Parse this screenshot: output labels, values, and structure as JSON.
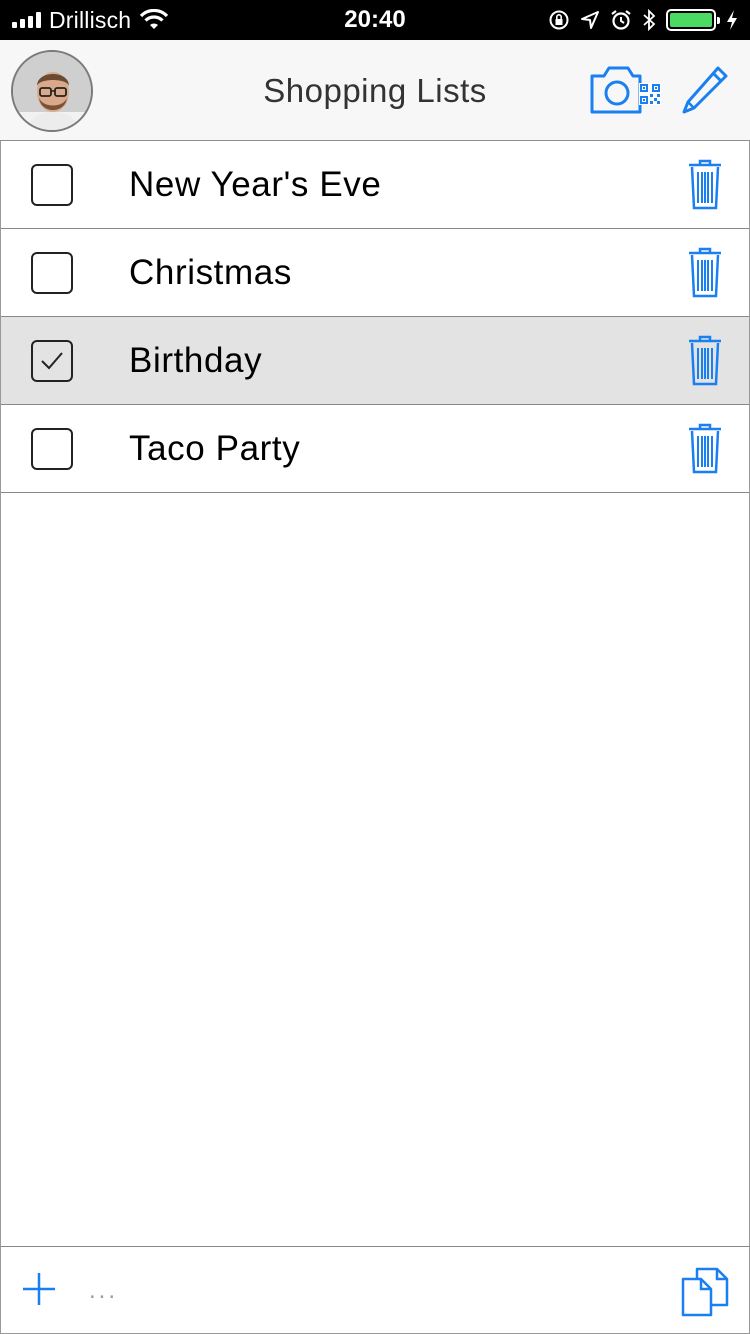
{
  "status_bar": {
    "carrier": "Drillisch",
    "time": "20:40",
    "battery_color": "#4cd964"
  },
  "nav": {
    "title": "Shopping Lists",
    "avatar_icon": "user-avatar",
    "scan_icon": "camera-qr-icon",
    "edit_icon": "pencil-icon",
    "accent_color": "#1a7ff0"
  },
  "lists": [
    {
      "label": "New Year's Eve",
      "checked": false
    },
    {
      "label": "Christmas",
      "checked": false
    },
    {
      "label": "Birthday",
      "checked": true
    },
    {
      "label": "Taco Party",
      "checked": false
    }
  ],
  "toolbar": {
    "add_icon": "plus-icon",
    "more_label": "...",
    "copy_icon": "copy-icon"
  }
}
